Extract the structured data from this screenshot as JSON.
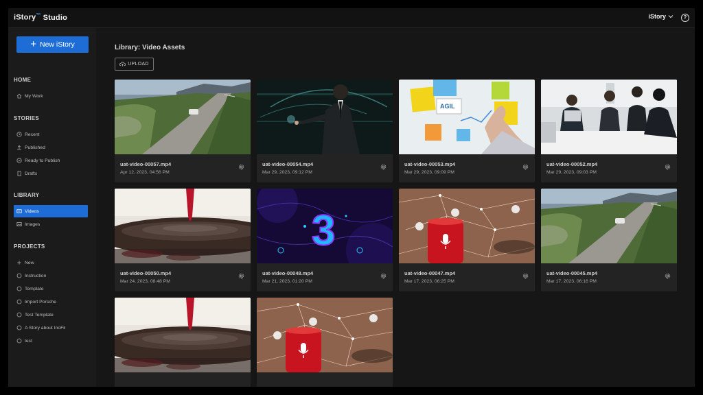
{
  "app": {
    "logo_main": "iStory",
    "logo_sup": "™",
    "logo_suffix": "Studio",
    "user_label": "iStory",
    "help_label": "?"
  },
  "sidebar": {
    "new_button": "New iStory",
    "sections": {
      "home": "HOME",
      "stories": "STORIES",
      "library": "LIBRARY",
      "projects": "PROJECTS"
    },
    "home_items": [
      {
        "label": "My Work",
        "icon": "home-icon"
      }
    ],
    "stories_items": [
      {
        "label": "Recent",
        "icon": "clock-icon"
      },
      {
        "label": "Published",
        "icon": "upload-icon"
      },
      {
        "label": "Ready to Publish",
        "icon": "check-circle-icon"
      },
      {
        "label": "Drafts",
        "icon": "document-icon"
      }
    ],
    "library_items": [
      {
        "label": "Videos",
        "icon": "video-icon",
        "active": true
      },
      {
        "label": "Images",
        "icon": "image-icon"
      }
    ],
    "projects_items": [
      {
        "label": "New",
        "icon": "plus-icon"
      },
      {
        "label": "Instruction",
        "icon": "circle-icon"
      },
      {
        "label": "Template",
        "icon": "circle-icon"
      },
      {
        "label": "Import Porsche",
        "icon": "circle-icon"
      },
      {
        "label": "Test Template",
        "icon": "circle-icon"
      },
      {
        "label": "A Story about InoFil",
        "icon": "circle-icon"
      },
      {
        "label": "test",
        "icon": "circle-icon"
      }
    ]
  },
  "main": {
    "title": "Library: Video Assets",
    "upload_label": "UPLOAD",
    "videos": [
      {
        "name": "uat-video-00057.mp4",
        "date": "Apr 12, 2023, 04:56 PM",
        "thumb": "road"
      },
      {
        "name": "uat-video-00054.mp4",
        "date": "Mar 29, 2023, 09:12 PM",
        "thumb": "suit"
      },
      {
        "name": "uat-video-00053.mp4",
        "date": "Mar 29, 2023, 09:09 PM",
        "thumb": "agile"
      },
      {
        "name": "uat-video-00052.mp4",
        "date": "Mar 29, 2023, 09:03 PM",
        "thumb": "meeting"
      },
      {
        "name": "uat-video-00050.mp4",
        "date": "Mar 24, 2023, 08:48 PM",
        "thumb": "drop"
      },
      {
        "name": "uat-video-00048.mp4",
        "date": "Mar 21, 2023, 01:20 PM",
        "thumb": "three"
      },
      {
        "name": "uat-video-00047.mp4",
        "date": "Mar 17, 2023, 06:25 PM",
        "thumb": "speaker"
      },
      {
        "name": "uat-video-00045.mp4",
        "date": "Mar 17, 2023, 06:16 PM",
        "thumb": "road"
      },
      {
        "name": "",
        "date": "",
        "thumb": "drop"
      },
      {
        "name": "",
        "date": "",
        "thumb": "speaker"
      }
    ]
  },
  "colors": {
    "accent": "#1e6dd6",
    "background": "#161616",
    "sidebar": "#1b1b1b",
    "card": "#232323"
  }
}
